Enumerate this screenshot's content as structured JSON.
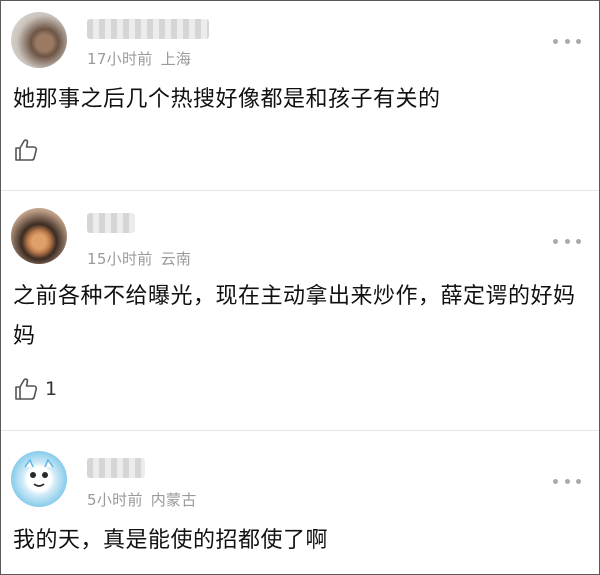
{
  "comments": [
    {
      "time": "17小时前",
      "location": "上海",
      "text": "她那事之后几个热搜好像都是和孩子有关的",
      "likes": "",
      "avatar_icon": "user-avatar",
      "like_icon": "thumbs-up-icon",
      "more_icon": "more-dots-icon"
    },
    {
      "time": "15小时前",
      "location": "云南",
      "text": "之前各种不给曝光，现在主动拿出来炒作，薛定谔的好妈妈",
      "likes": "1",
      "avatar_icon": "user-avatar",
      "like_icon": "thumbs-up-icon",
      "more_icon": "more-dots-icon"
    },
    {
      "time": "5小时前",
      "location": "内蒙古",
      "text": "我的天，真是能使的招都使了啊",
      "likes": "",
      "avatar_icon": "user-avatar",
      "like_icon": "thumbs-up-icon",
      "more_icon": "more-dots-icon"
    }
  ],
  "colors": {
    "meta_text": "#9a9a9a",
    "body_text": "#111111",
    "divider": "#e6e6e6",
    "icon": "#a9a9a9"
  }
}
